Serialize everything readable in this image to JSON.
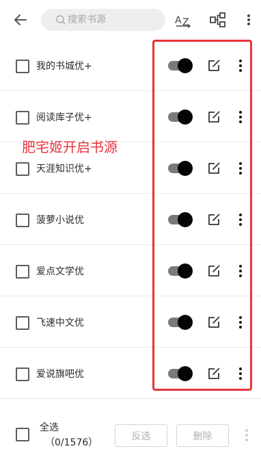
{
  "header": {
    "search_placeholder": "搜索书源",
    "icons": [
      "back-arrow-icon",
      "search-icon",
      "sort-az-icon",
      "tree-structure-icon",
      "more-vertical-icon"
    ]
  },
  "annotation": {
    "text": "肥宅姬开启书源",
    "color": "#e9333a"
  },
  "sources": [
    {
      "name": "我的书城优+",
      "enabled": true,
      "checked": false
    },
    {
      "name": "阅读库子优+",
      "enabled": true,
      "checked": false
    },
    {
      "name": "天涯知识优+",
      "enabled": true,
      "checked": false
    },
    {
      "name": "菠萝小说优",
      "enabled": true,
      "checked": false
    },
    {
      "name": "爱点文学优",
      "enabled": true,
      "checked": false
    },
    {
      "name": "飞速中文优",
      "enabled": true,
      "checked": false
    },
    {
      "name": "爱说旗吧优",
      "enabled": true,
      "checked": false
    }
  ],
  "footer": {
    "select_all_label": "全选",
    "count_text": "（0/1576）",
    "invert_label": "反选",
    "delete_label": "删除"
  },
  "colors": {
    "highlight": "#e9333a",
    "switch_knob": "#050505",
    "switch_track": "#7a7a7a"
  }
}
